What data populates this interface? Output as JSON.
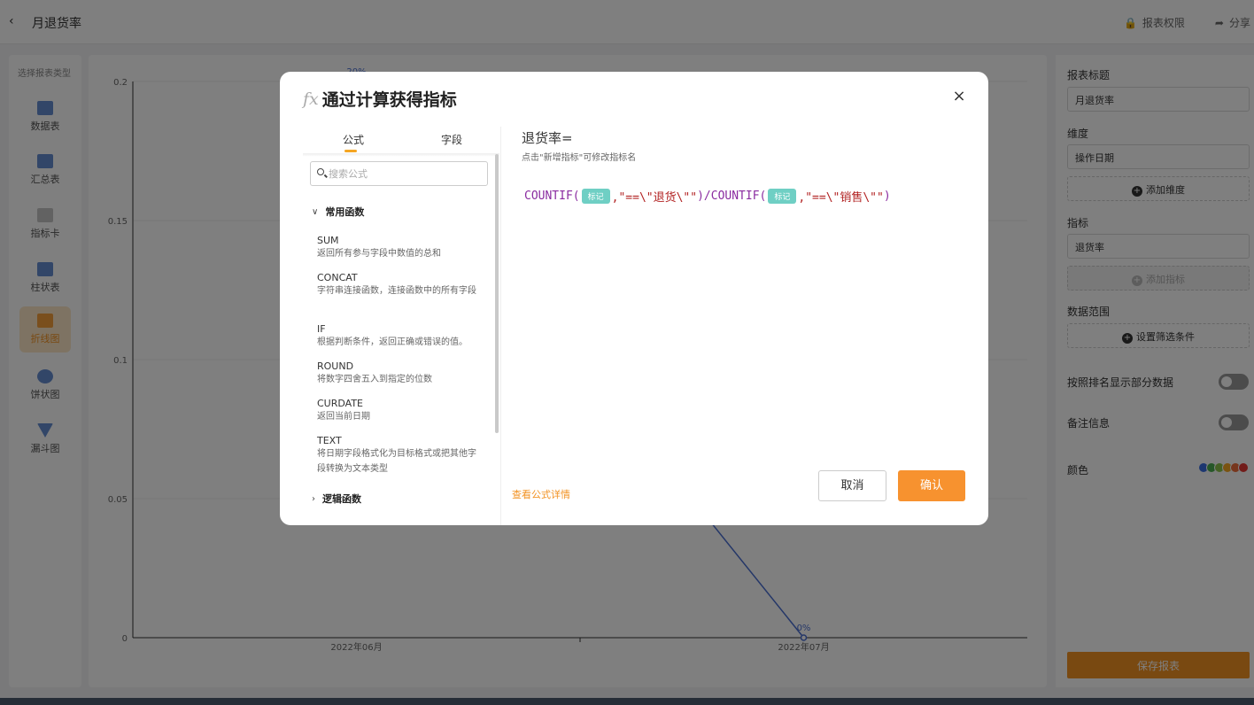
{
  "page": {
    "title": "月退货率",
    "actions": [
      {
        "label": "报表权限",
        "icon": "lock-icon"
      },
      {
        "label": "分享",
        "icon": "share-icon"
      }
    ]
  },
  "left_panel": {
    "title": "选择报表类型",
    "types": [
      {
        "label": "数据表",
        "icon": "table-icon"
      },
      {
        "label": "汇总表",
        "icon": "summary-table-icon"
      },
      {
        "label": "指标卡",
        "icon": "metric-card-icon"
      },
      {
        "label": "柱状表",
        "icon": "bar-chart-icon"
      },
      {
        "label": "折线图",
        "icon": "line-chart-icon",
        "active": true
      },
      {
        "label": "饼状图",
        "icon": "pie-chart-icon"
      },
      {
        "label": "漏斗图",
        "icon": "funnel-chart-icon"
      }
    ]
  },
  "chart_data": {
    "type": "line",
    "categories": [
      "2022年06月",
      "2022年07月"
    ],
    "series": [
      {
        "values": [
          0.2,
          0
        ],
        "labels": [
          "20%",
          "0%"
        ]
      }
    ],
    "yticks": [
      "0",
      "0.05",
      "0.1",
      "0.15",
      "0.2"
    ],
    "ylim": [
      0,
      0.2
    ],
    "grid": true,
    "color": "#4a6fd1"
  },
  "right_panel": {
    "report_title_label": "报表标题",
    "report_title_value": "月退货率",
    "dimension_label": "维度",
    "dimension_value": "操作日期",
    "add_dimension": "添加维度",
    "metric_label": "指标",
    "metric_value": "退货率",
    "add_metric": "添加指标",
    "range_label": "数据范围",
    "set_filter": "设置筛选条件",
    "rank_toggle_label": "按照排名显示部分数据",
    "note_toggle_label": "备注信息",
    "color_label": "颜色",
    "colors": [
      "#3b6fe0",
      "#4caf50",
      "#8bc34a",
      "#f5a623",
      "#ef6c3a",
      "#e53935"
    ],
    "save": "保存报表"
  },
  "modal": {
    "title": "通过计算获得指标",
    "fx": "fx",
    "close": "×",
    "tabs": [
      "公式",
      "字段"
    ],
    "search_placeholder": "搜索公式",
    "groups": [
      {
        "name": "常用函数",
        "expanded": true
      },
      {
        "name": "逻辑函数",
        "expanded": false
      }
    ],
    "functions": [
      {
        "name": "SUM",
        "desc": "返回所有参与字段中数值的总和"
      },
      {
        "name": "CONCAT",
        "desc": "字符串连接函数，连接函数中的所有字段"
      },
      {
        "name": "IF",
        "desc": "根据判断条件，返回正确或错误的值。"
      },
      {
        "name": "ROUND",
        "desc": "将数字四舍五入到指定的位数"
      },
      {
        "name": "CURDATE",
        "desc": "返回当前日期"
      },
      {
        "name": "TEXT",
        "desc": "将日期字段格式化为目标格式或把其他字段转换为文本类型"
      }
    ],
    "formula_name": "退货率=",
    "formula_hint": "点击\"新增指标\"可修改指标名",
    "formula": {
      "fn1": "COUNTIF(",
      "chip1": "标记",
      "arg1": ",\"==\\\"退货\\\"\"",
      "mid": ")/COUNTIF(",
      "chip2": "标记",
      "arg2": ",\"==\\\"销售\\\"\"",
      "end": ")"
    },
    "detail_link": "查看公式详情",
    "cancel": "取消",
    "confirm": "确认"
  }
}
